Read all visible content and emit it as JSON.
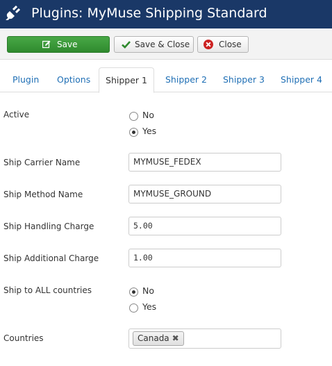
{
  "header": {
    "title": "Plugins: MyMuse Shipping Standard",
    "icon": "plug-icon",
    "background": "#1a3867"
  },
  "toolbar": {
    "save_label": "Save",
    "save_close_label": "Save & Close",
    "close_label": "Close",
    "save_color": "#3d9b3b"
  },
  "tabs": [
    {
      "label": "Plugin",
      "active": false
    },
    {
      "label": "Options",
      "active": false
    },
    {
      "label": "Shipper 1",
      "active": true
    },
    {
      "label": "Shipper 2",
      "active": false
    },
    {
      "label": "Shipper 3",
      "active": false
    },
    {
      "label": "Shipper 4",
      "active": false
    }
  ],
  "form": {
    "active": {
      "label": "Active",
      "options": [
        "No",
        "Yes"
      ],
      "selected": "Yes"
    },
    "carrier_name": {
      "label": "Ship Carrier Name",
      "value": "MYMUSE_FEDEX"
    },
    "method_name": {
      "label": "Ship Method Name",
      "value": "MYMUSE_GROUND"
    },
    "handling_charge": {
      "label": "Ship Handling Charge",
      "value": "5.00"
    },
    "additional_charge": {
      "label": "Ship Additional Charge",
      "value": "1.00"
    },
    "all_countries": {
      "label": "Ship to ALL countries",
      "options": [
        "No",
        "Yes"
      ],
      "selected": "No"
    },
    "countries": {
      "label": "Countries",
      "selected": [
        "Canada"
      ],
      "remove_glyph": "✖"
    }
  },
  "colors": {
    "link": "#1f6fb5",
    "close_icon": "#cc2222"
  }
}
